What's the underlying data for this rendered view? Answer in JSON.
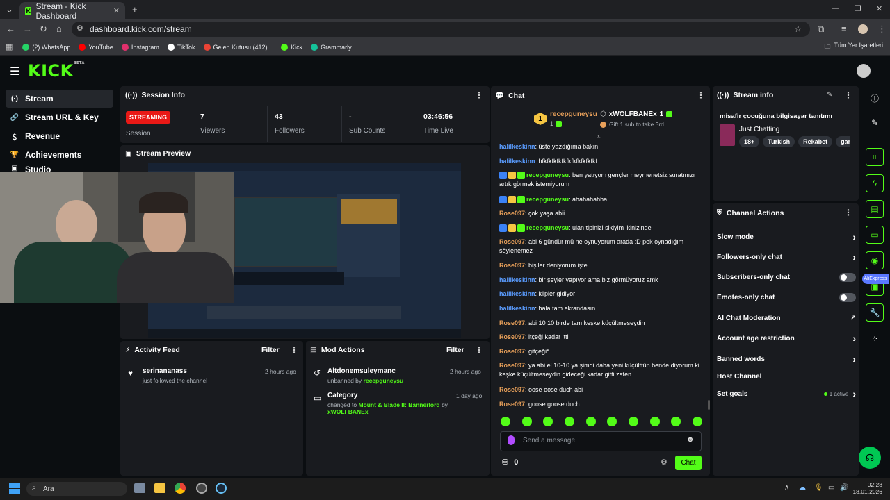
{
  "browser": {
    "tab_title": "Stream - Kick Dashboard",
    "url": "dashboard.kick.com/stream",
    "bookmarks": [
      {
        "label": "(2) WhatsApp",
        "color": "#25d366"
      },
      {
        "label": "YouTube",
        "color": "#ff0000"
      },
      {
        "label": "Instagram",
        "color": "#e1306c"
      },
      {
        "label": "TikTok",
        "color": "#ffffff"
      },
      {
        "label": "Gelen Kutusu (412)...",
        "color": "#ea4335"
      },
      {
        "label": "Kick",
        "color": "#53fc18"
      },
      {
        "label": "Grammarly",
        "color": "#15c39a"
      }
    ],
    "all_bookmarks": "Tüm Yer İşaretleri"
  },
  "kick": {
    "logo": "KICK",
    "logo_badge": "BETA",
    "accent": "#53fc18"
  },
  "sidebar": {
    "items": [
      {
        "label": "Stream",
        "icon": "broadcast-icon"
      },
      {
        "label": "Stream URL & Key",
        "icon": "link-icon"
      },
      {
        "label": "Revenue",
        "icon": "dollar-icon"
      },
      {
        "label": "Achievements",
        "icon": "trophy-icon"
      },
      {
        "label": "Studio",
        "icon": "studio-icon"
      }
    ]
  },
  "session": {
    "title": "Session Info",
    "status": "STREAMING",
    "status_label": "Session",
    "stats": [
      {
        "value": "7",
        "label": "Viewers"
      },
      {
        "value": "43",
        "label": "Followers"
      },
      {
        "value": "-",
        "label": "Sub Counts"
      },
      {
        "value": "03:46:56",
        "label": "Time Live"
      }
    ]
  },
  "preview": {
    "title": "Stream Preview"
  },
  "activity": {
    "title": "Activity Feed",
    "filter": "Filter",
    "items": [
      {
        "user": "serinananass",
        "text": "just followed the channel",
        "time": "2 hours ago"
      }
    ]
  },
  "mod": {
    "title": "Mod Actions",
    "filter": "Filter",
    "items": [
      {
        "title": "Altdonemsuleymanc",
        "prefix": "unbanned by",
        "actor": "recepguneysu",
        "suffix": "",
        "time": "2 hours ago"
      },
      {
        "title": "Category",
        "prefix": "changed to",
        "actor": "Mount & Blade II: Bannerlord",
        "suffix": "by",
        "actor2": "xWOLFBANEx",
        "time": "1 day ago"
      }
    ]
  },
  "chat": {
    "title": "Chat",
    "top_gifter": {
      "rank": "1",
      "name": "recepguneysu",
      "count": "1"
    },
    "second": {
      "name": "xWOLFBANEx",
      "count": "1",
      "gift_text": "Gift 1 sub to take 3rd"
    },
    "messages": [
      {
        "user": "halilkeskinn",
        "color": "blue",
        "badges": false,
        "text": "üste yazdığıma bakın"
      },
      {
        "user": "halilkeskinn",
        "color": "blue",
        "badges": false,
        "text": "hfkfkfkfkfkfkfkfkfkfkfkf"
      },
      {
        "user": "recepguneysu",
        "color": "orange",
        "badges": true,
        "text": "ben yatıyom gençler meymenetsiz suratınızı artık görmek istemiyorum"
      },
      {
        "user": "recepguneysu",
        "color": "orange",
        "badges": true,
        "text": "ahahahahha"
      },
      {
        "user": "Rose097",
        "color": "orange2",
        "badges": false,
        "text": "çok yaşa abii"
      },
      {
        "user": "recepguneysu",
        "color": "orange",
        "badges": true,
        "text": "ulan tipinizi sikiyim ikinizinde"
      },
      {
        "user": "Rose097",
        "color": "orange2",
        "badges": false,
        "text": "abi 6 gündür mü ne oynuyorum arada :D pek oynadığım söylenemez"
      },
      {
        "user": "Rose097",
        "color": "orange2",
        "badges": false,
        "text": "bişiler deniyorum işte"
      },
      {
        "user": "halilkeskinn",
        "color": "blue",
        "badges": false,
        "text": "bir şeyler yapıyor ama biz görmüyoruz amk"
      },
      {
        "user": "halilkeskinn",
        "color": "blue",
        "badges": false,
        "text": "klipler gidiyor"
      },
      {
        "user": "halilkeskinn",
        "color": "blue",
        "badges": false,
        "text": "hala tam ekrandasın"
      },
      {
        "user": "Rose097",
        "color": "orange2",
        "badges": false,
        "text": "abi 10 10 birde tam keşke küçültmeseydin"
      },
      {
        "user": "Rose097",
        "color": "orange2",
        "badges": false,
        "text": "itçeği kadar itti"
      },
      {
        "user": "Rose097",
        "color": "orange2",
        "badges": false,
        "text": "gitçeği*"
      },
      {
        "user": "Rose097",
        "color": "orange2",
        "badges": false,
        "text": "ya abi el 10-10 ya şimdi daha yeni küçülttün bende diyorum ki keşke küçültmeseydin gideceği kadar gitti zaten"
      },
      {
        "user": "Rose097",
        "color": "orange2",
        "badges": false,
        "text": "oose oose duch abi"
      },
      {
        "user": "Rose097",
        "color": "orange2",
        "badges": false,
        "text": "goose goose duch"
      }
    ],
    "placeholder": "Send a message",
    "points": "0",
    "send": "Chat"
  },
  "stream_info": {
    "title": "Stream info",
    "stream_title": "misafir çocuğuna bilgisayar tanıtımı",
    "category": "Just Chatting",
    "tags": [
      "18+",
      "Turkish",
      "Rekabet",
      "game"
    ]
  },
  "channel_actions": {
    "title": "Channel Actions",
    "rows": [
      {
        "label": "Slow mode",
        "control": "chevron"
      },
      {
        "label": "Followers-only chat",
        "control": "chevron"
      },
      {
        "label": "Subscribers-only chat",
        "control": "toggle"
      },
      {
        "label": "Emotes-only chat",
        "control": "toggle"
      },
      {
        "label": "AI Chat Moderation",
        "control": "external"
      },
      {
        "label": "Account age restriction",
        "control": "chevron"
      },
      {
        "label": "Banned words",
        "control": "chevron"
      },
      {
        "label": "Host Channel",
        "control": "none"
      },
      {
        "label": "Set goals",
        "control": "chevron",
        "extra": "1 active"
      }
    ]
  },
  "aliexpress": "AliExpress",
  "taskbar": {
    "search": "Ara",
    "time": "02:28",
    "date": "18.01.2026"
  }
}
